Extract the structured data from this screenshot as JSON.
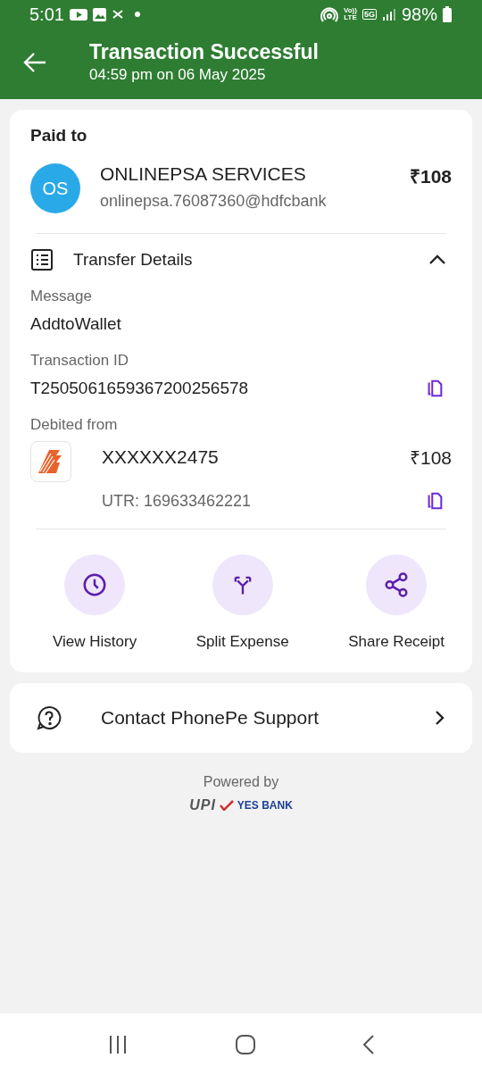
{
  "status_bar": {
    "time": "5:01",
    "volte_top": "Vo))",
    "volte_bottom": "LTE",
    "network": "5G",
    "battery": "98%"
  },
  "header": {
    "title": "Transaction Successful",
    "subtitle": "04:59 pm on 06 May 2025"
  },
  "paid_to": {
    "heading": "Paid to",
    "initials": "OS",
    "name": "ONLINEPSA SERVICES",
    "upi_id": "onlinepsa.76087360@hdfcbank",
    "amount": "₹108"
  },
  "transfer_details": {
    "title": "Transfer Details",
    "expanded": true,
    "fields": [
      {
        "label": "Message",
        "value": "AddtoWallet",
        "copyable": false
      },
      {
        "label": "Transaction ID",
        "value": "T2505061659367200256578",
        "copyable": true
      }
    ],
    "debited": {
      "label": "Debited from",
      "account": "XXXXXX2475",
      "amount": "₹108",
      "utr": "UTR: 169633462221"
    }
  },
  "actions": [
    {
      "kind": "history",
      "label": "View History"
    },
    {
      "kind": "split",
      "label": "Split Expense"
    },
    {
      "kind": "share",
      "label": "Share Receipt"
    }
  ],
  "support": {
    "label": "Contact PhonePe Support"
  },
  "footer": {
    "powered_by": "Powered by",
    "upi": "UPI",
    "bank": "YES BANK"
  }
}
